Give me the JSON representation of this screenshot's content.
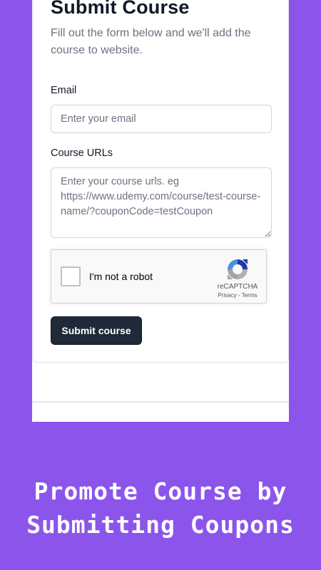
{
  "form": {
    "title": "Submit Course",
    "subtitle": "Fill out the form below and we'll add the course to website.",
    "email": {
      "label": "Email",
      "placeholder": "Enter your email",
      "value": ""
    },
    "urls": {
      "label": "Course URLs",
      "placeholder": "Enter your course urls. eg https://www.udemy.com/course/test-course-name/?couponCode=testCoupon",
      "value": ""
    },
    "captcha": {
      "checkbox_label": "I'm not a robot",
      "brand": "reCAPTCHA",
      "links": "Privacy - Terms",
      "icon": "recaptcha-logo-icon"
    },
    "submit_label": "Submit course"
  },
  "promo": {
    "line1": "Promote Course by",
    "line2": "Submitting Coupons"
  },
  "colors": {
    "background": "#8b55ec",
    "button": "#1f2937",
    "text": "#111827",
    "muted": "#6b7280",
    "recaptcha_blue": "#1c3aa9",
    "recaptcha_lightblue": "#4a90e2",
    "recaptcha_gray": "#b0b0b0"
  }
}
